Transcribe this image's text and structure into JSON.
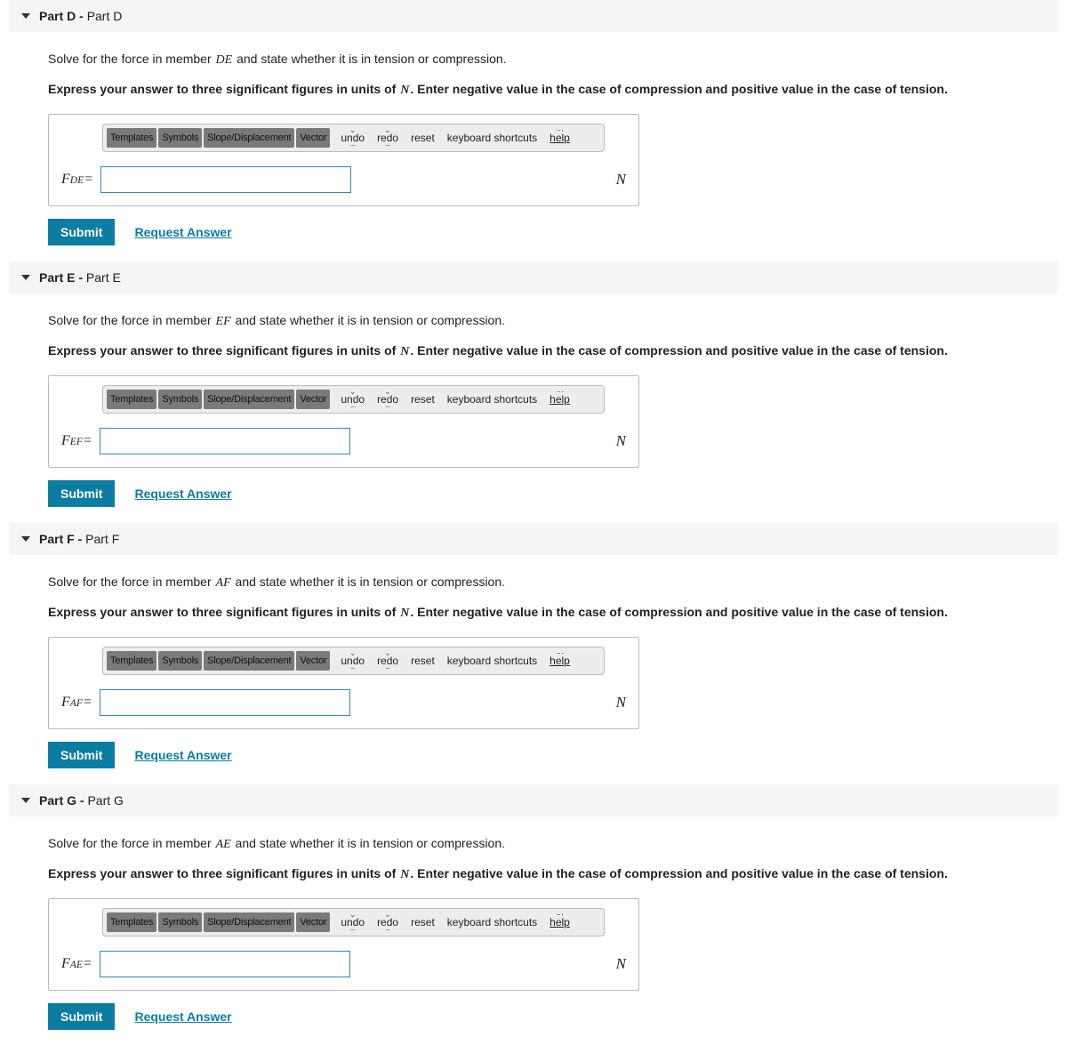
{
  "common": {
    "prompt_pre": "Solve for the force in member ",
    "prompt_post": " and state whether it is in tension or compression.",
    "instr_pre": "Express your answer to three significant figures in units of ",
    "instr_unit": "N",
    "instr_post": ". Enter negative value in the case of compression and positive value in the case of tension.",
    "unit_label": "N",
    "eq": "=",
    "toolbar": {
      "templates": "Templates",
      "symbols": "Symbols",
      "slope": "Slope/Displacement",
      "vector": "Vector",
      "undo": "undo",
      "redo": "redo",
      "reset": "reset",
      "kbd": "keyboard shortcuts",
      "help": "help"
    },
    "submit": "Submit",
    "request": "Request Answer"
  },
  "parts": {
    "D": {
      "header_bold": "Part D - ",
      "header_rest": "Part D",
      "member": "DE",
      "var_letter": "F",
      "var_sub": "DE"
    },
    "E": {
      "header_bold": "Part E - ",
      "header_rest": "Part E",
      "member": "EF",
      "var_letter": "F",
      "var_sub": "EF"
    },
    "F": {
      "header_bold": "Part F - ",
      "header_rest": "Part F",
      "member": "AF",
      "var_letter": "F",
      "var_sub": "AF"
    },
    "G": {
      "header_bold": "Part G - ",
      "header_rest": "Part G",
      "member": "AE",
      "var_letter": "F",
      "var_sub": "AE"
    }
  }
}
